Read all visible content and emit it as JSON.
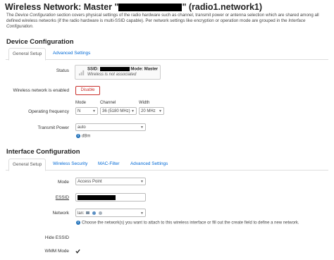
{
  "title": {
    "prefix": "Wireless Network: Master \"",
    "suffix": "\" (radio1.network1)"
  },
  "description": {
    "p1": "The ",
    "em1": "Device Configuration",
    "p2": " section covers physical settings of the radio hardware such as channel, transmit power or antenna selection which are shared among all defined wireless networks (if the radio hardware is multi-SSID capable). Per network settings like encryption or operation mode are grouped in the ",
    "em2": "Interface Configuration",
    "p3": "."
  },
  "device": {
    "heading": "Device Configuration",
    "tabs": [
      "General Setup",
      "Advanced Settings"
    ],
    "status": {
      "label": "Status",
      "ssid_label": "SSID:",
      "mode_text": "Mode: Master",
      "note": "Wireless is not associated"
    },
    "enabled": {
      "label": "Wireless network is enabled",
      "button": "Disable"
    },
    "frequency": {
      "label": "Operating frequency",
      "mode_label": "Mode",
      "mode_value": "N",
      "channel_label": "Channel",
      "channel_value": "36 (5180 MHz)",
      "width_label": "Width",
      "width_value": "20 MHz"
    },
    "power": {
      "label": "Transmit Power",
      "value": "auto",
      "unit": "dBm"
    }
  },
  "iface": {
    "heading": "Interface Configuration",
    "tabs": [
      "General Setup",
      "Wireless Security",
      "MAC-Filter",
      "Advanced Settings"
    ],
    "mode": {
      "label": "Mode",
      "value": "Access Point"
    },
    "essid": {
      "label": "ESSID"
    },
    "network": {
      "label": "Network",
      "value": "lan:",
      "hint": "Choose the network(s) you want to attach to this wireless interface or fill out the create field to define a new network."
    },
    "hide": {
      "label": "Hide ESSID"
    },
    "wmm": {
      "label": "WMM Mode",
      "checked": true
    }
  }
}
